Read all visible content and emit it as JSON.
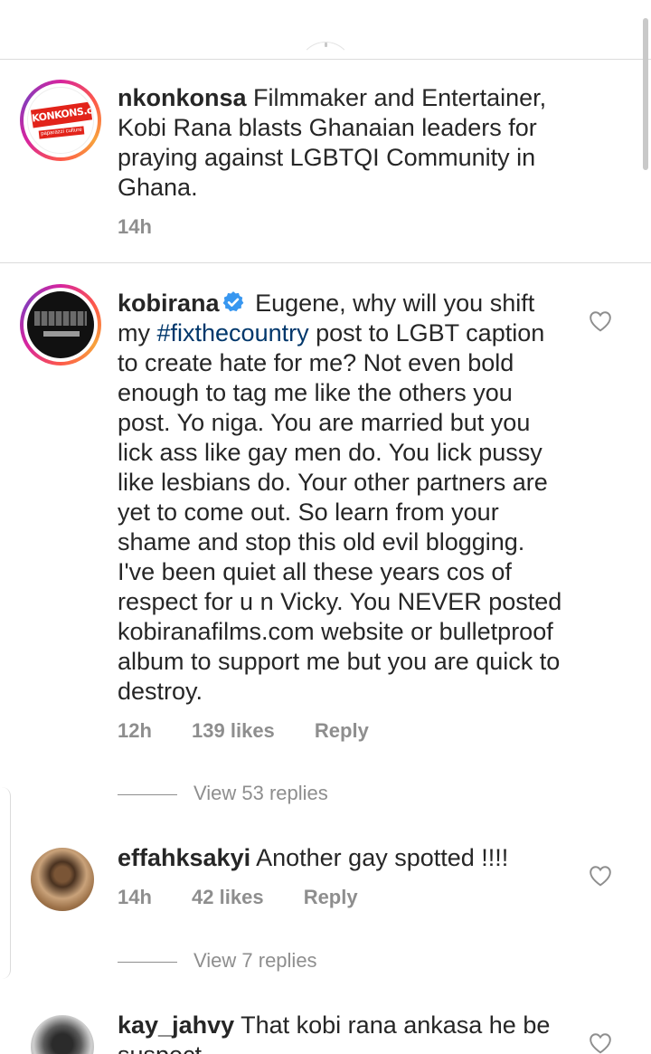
{
  "post_caption": {
    "username": "nkonkonsa",
    "text": "Filmmaker and Entertainer, Kobi Rana blasts Ghanaian leaders for praying against LGBTQI Community in Ghana.",
    "time": "14h",
    "avatar": {
      "logo_text": "KONKONS.com",
      "tagline": "paparazzi culture"
    }
  },
  "comments": [
    {
      "username": "kobirana",
      "verified": true,
      "text_before": "Eugene, why will you shift my ",
      "hashtag": "#fixthecountry",
      "text_after": " post to LGBT caption to create hate for me? Not even bold enough to tag me like the others you post. Yo niga. You are married but you lick ass like gay men do. You lick pussy like lesbians do. Your other partners are yet to come out. So learn from your shame and stop this old evil blogging. I've been quiet all these years cos of respect for u n Vicky. You NEVER posted kobiranafilms.com website or bulletproof album to support me but you are quick to destroy.",
      "time": "12h",
      "likes": "139 likes",
      "reply_label": "Reply",
      "view_replies": "View 53 replies"
    },
    {
      "username": "effahksakyi",
      "text": "Another gay spotted !!!!",
      "time": "14h",
      "likes": "42 likes",
      "reply_label": "Reply",
      "view_replies": "View 7 replies"
    },
    {
      "username": "kay_jahvy",
      "text": "That kobi rana ankasa he be suspect"
    }
  ],
  "colors": {
    "hashtag": "#00376b",
    "verified": "#3897f0",
    "meta": "#8e8e8e"
  },
  "icons": [
    "heart-outline-icon",
    "verified-badge-icon"
  ]
}
